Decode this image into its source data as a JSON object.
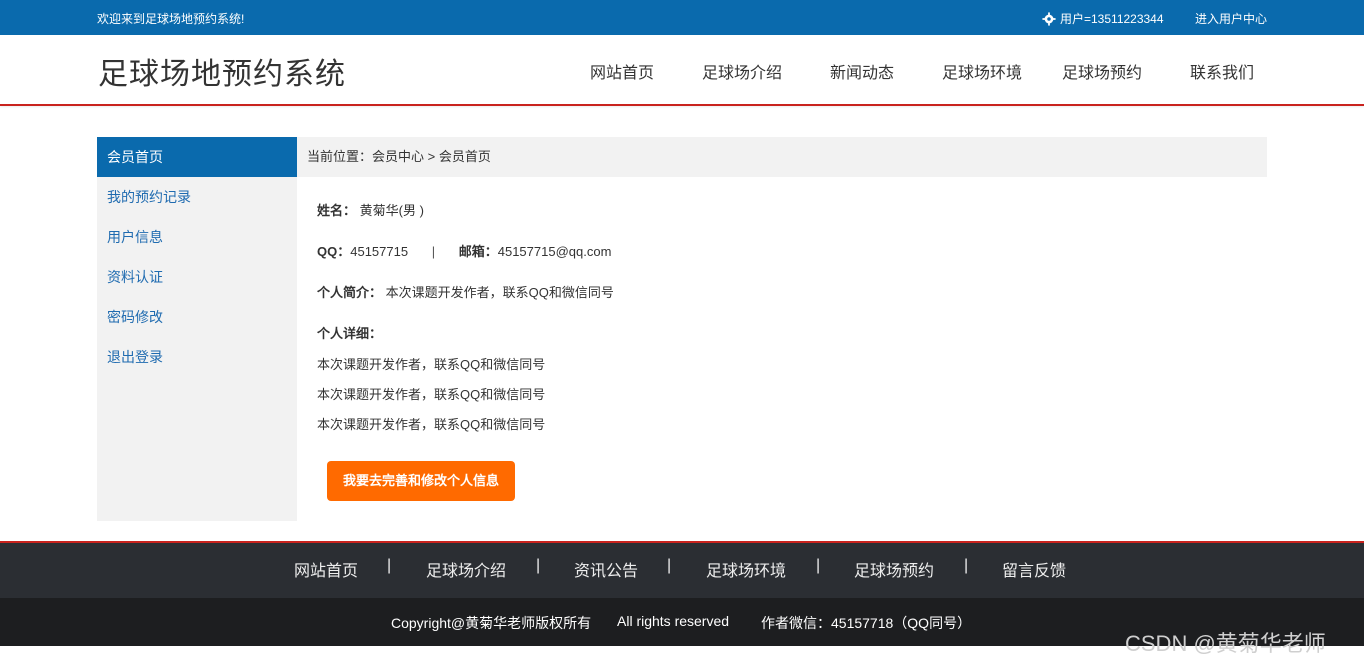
{
  "topbar": {
    "welcome": "欢迎来到足球场地预约系统!",
    "user": "用户=13511223344",
    "user_center": "进入用户中心"
  },
  "header": {
    "title": "足球场地预约系统",
    "nav": [
      "网站首页",
      "足球场介绍",
      "新闻动态",
      "足球场环境",
      "足球场预约",
      "联系我们"
    ]
  },
  "sidebar": {
    "items": [
      "会员首页",
      "我的预约记录",
      "用户信息",
      "资料认证",
      "密码修改",
      "退出登录"
    ]
  },
  "breadcrumb": "当前位置：会员中心 > 会员首页",
  "profile": {
    "name_label": "姓名：",
    "name_value": "黄菊华(男 )",
    "qq_label": "QQ：",
    "qq_value": "45157715",
    "divider": "|",
    "email_label": "邮箱：",
    "email_value": "45157715@qq.com",
    "intro_label": "个人简介：",
    "intro_value": "本次课题开发作者，联系QQ和微信同号",
    "detail_label": "个人详细：",
    "detail_lines": [
      "本次课题开发作者，联系QQ和微信同号",
      "本次课题开发作者，联系QQ和微信同号",
      "本次课题开发作者，联系QQ和微信同号"
    ],
    "edit_button": "我要去完善和修改个人信息"
  },
  "footer": {
    "nav": [
      "网站首页",
      "足球场介绍",
      "资讯公告",
      "足球场环境",
      "足球场预约",
      "留言反馈"
    ],
    "separator": "|",
    "copyright": "Copyright@黄菊华老师版权所有",
    "rights": "All rights reserved",
    "wechat": "作者微信：45157718（QQ同号）"
  },
  "watermark": "CSDN @黄菊华老师",
  "colors": {
    "primary": "#0a6aad",
    "accent": "#ff6a00",
    "header_border": "#c9231e",
    "footer_dark": "#2b2e33"
  }
}
